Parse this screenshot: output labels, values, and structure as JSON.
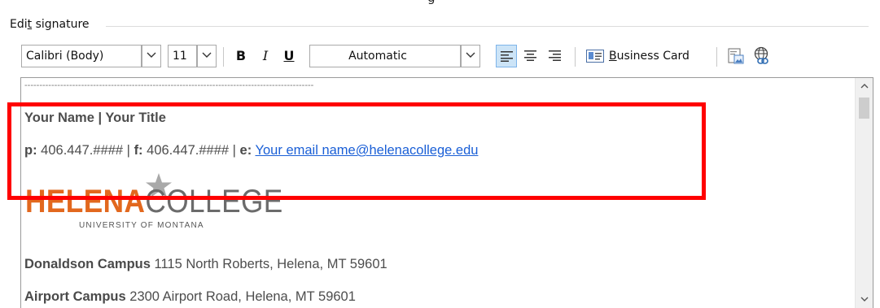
{
  "dialog": {
    "top_fragment": "g",
    "section_title_prefix": "Edi",
    "section_title_underlined": "t",
    "section_title_suffix": " signature"
  },
  "toolbar": {
    "font_family": "Calibri (Body)",
    "font_size": "11",
    "bold_label": "B",
    "italic_label": "I",
    "underline_label": "U",
    "color_label": "Automatic",
    "alignment_active": "left",
    "business_card_underlined": "B",
    "business_card_rest": "usiness Card"
  },
  "signature": {
    "separator": "-------------------------------------------------------------------------------------------------",
    "name_title": "Your Name | Your Title",
    "contact_p_label": "p:",
    "contact_p_value": " 406.447.#### | ",
    "contact_f_label": "f:",
    "contact_f_value": " 406.447.#### | ",
    "contact_e_label": "e:",
    "email": "Your email name@helenacollege.edu",
    "logo_word_1": "HELENA",
    "logo_word_2": "COLLEGE",
    "logo_subtitle": "UNIVERSITY OF MONTANA",
    "campus1_name": "Donaldson Campus",
    "campus1_address": " 1115 North Roberts, Helena, MT 59601",
    "campus2_name": "Airport Campus",
    "campus2_address": " 2300 Airport Road, Helena, MT 59601"
  },
  "colors": {
    "highlight_box": "#ff0000",
    "link": "#1a5fd6",
    "logo_orange": "#e2681e"
  }
}
